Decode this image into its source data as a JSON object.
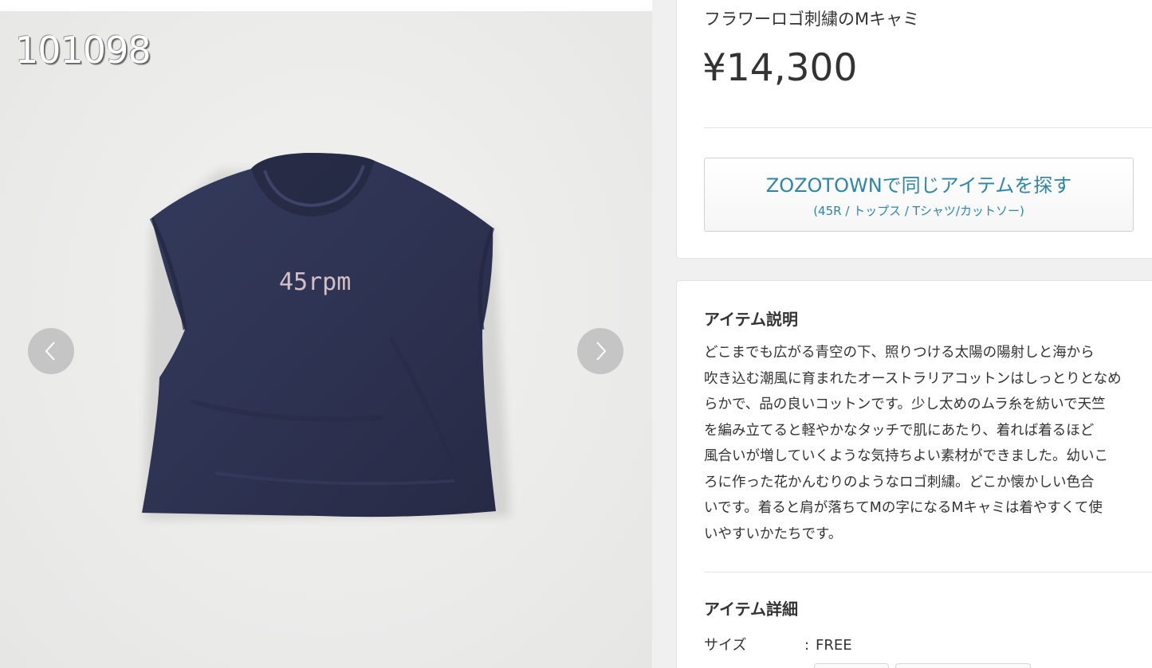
{
  "gallery": {
    "watermark_id": "101098",
    "shirt_logo": "45rpm",
    "prev_icon": "chevron-left-icon",
    "next_icon": "chevron-right-icon"
  },
  "product": {
    "title": "フラワーロゴ刺繍のMキャミ",
    "price": "¥14,300"
  },
  "zozotown": {
    "label": "ZOZOTOWNで同じアイテムを探す",
    "category": "(45R / トップス / Tシャツ/カットソー)"
  },
  "description": {
    "heading": "アイテム説明",
    "lines": [
      "どこまでも広がる青空の下、照りつける太陽の陽射しと海から",
      "吹き込む潮風に育まれたオーストラリアコットンはしっとりとなめ",
      "らかで、品の良いコットンです。少し太めのムラ糸を紡いで天竺",
      "を編み立てると軽やかなタッチで肌にあたり、着れば着るほど",
      "風合いが増していくような気持ちよい素材ができました。幼いこ",
      "ろに作った花かんむりのようなロゴ刺繍。どこか懐かしい色合",
      "いです。着ると肩が落ちてMの字になるMキャミは着やすくて使",
      "いやすいかたちです。"
    ]
  },
  "details": {
    "heading": "アイテム詳細",
    "size_label": "サイズ",
    "separator": ":",
    "size_value": "FREE"
  },
  "colors": {
    "accent": "#2d86a8",
    "shirt": "#2e3352",
    "background": "#f0f0f0"
  }
}
